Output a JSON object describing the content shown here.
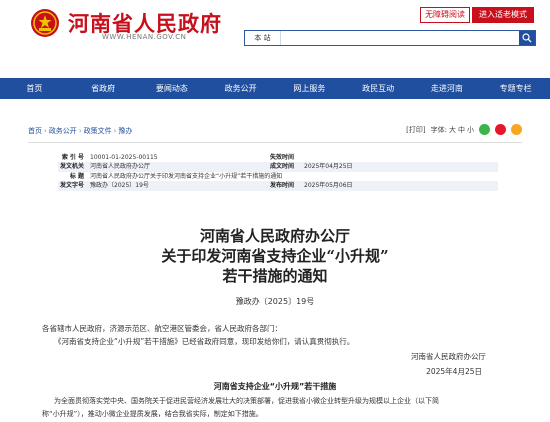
{
  "header": {
    "site_title": "河南省人民政府",
    "site_url": "WWW.HENAN.GOV.CN",
    "accessible_label": "无障碍阅读",
    "elder_mode_label": "进入适老模式",
    "search_scope": "本 站"
  },
  "nav": [
    "首页",
    "省政府",
    "要闻动态",
    "政务公开",
    "网上服务",
    "政民互动",
    "走进河南",
    "专题专栏"
  ],
  "breadcrumb": [
    "首页",
    "政务公开",
    "政策文件",
    "豫办"
  ],
  "tools": {
    "print": "[打印]",
    "font_label": "字体:",
    "large": "大",
    "medium": "中",
    "small": "小"
  },
  "meta": {
    "index_label": "索 引 号",
    "index_value": "10001-01-2025-00115",
    "invalid_label": "失效时间",
    "invalid_value": "",
    "issuer_label": "发文机关",
    "issuer_value": "河南省人民政府办公厅",
    "date_label": "成文时间",
    "date_value": "2025年04月25日",
    "subject_label": "标 题",
    "subject_value": "河南省人民政府办公厅关于印发河南省支持企业“小升规”若干措施的通知",
    "docno_label": "发文字号",
    "docno_value": "豫政办〔2025〕19号",
    "pub_label": "发布时间",
    "pub_value": "2025年05月06日"
  },
  "document": {
    "title_line1": "河南省人民政府办公厅",
    "title_line2": "关于印发河南省支持企业“小升规”",
    "title_line3": "若干措施的通知",
    "doc_number": "豫政办〔2025〕19号",
    "salutation": "各省辖市人民政府，济源示范区、航空港区管委会，省人民政府各部门：",
    "body": "《河南省支持企业“小升规”若干措施》已经省政府同意，现印发给你们，请认真贯彻执行。",
    "signature_org": "河南省人民政府办公厅",
    "signature_date": "2025年4月25日",
    "subtitle": "河南省支持企业“小升规”若干措施",
    "para1_line1": "为全面贯彻落实党中央、国务院关于促进民营经济发展壮大的决策部署，促进我省小微企业转型升级为规模以上企业（以下简",
    "para1_line2": "称“小升规”），推动小微企业提质发展，结合我省实际，制定如下措施。"
  },
  "colors": {
    "brand_red": "#c8101c",
    "nav_blue": "#1f4f9e"
  }
}
